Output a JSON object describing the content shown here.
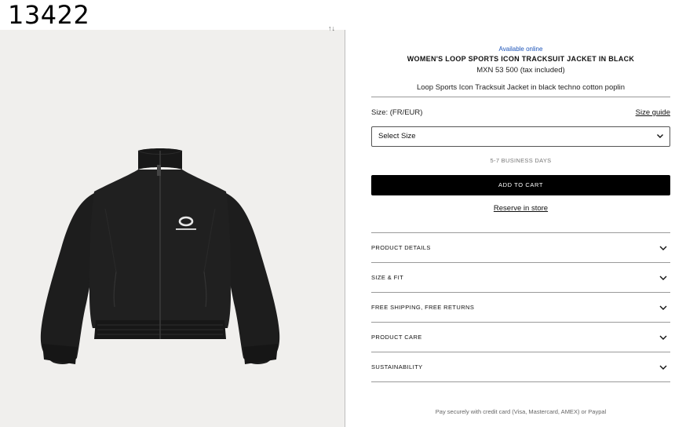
{
  "frame_id": "13422",
  "gallery": {
    "marker": "↑↓"
  },
  "product": {
    "availability": "Available online",
    "title": "WOMEN'S LOOP SPORTS ICON TRACKSUIT JACKET IN BLACK",
    "price": "MXN 53 500 (tax included)",
    "description": "Loop Sports Icon Tracksuit Jacket in black techno cotton poplin"
  },
  "size": {
    "label": "Size: (FR/EUR)",
    "guide_link": "Size guide",
    "select_value": "Select Size"
  },
  "delivery": "5-7 BUSINESS DAYS",
  "cart_button": "ADD TO CART",
  "reserve_link": "Reserve in store",
  "accordion": [
    {
      "label": "PRODUCT DETAILS"
    },
    {
      "label": "SIZE & FIT"
    },
    {
      "label": "FREE SHIPPING, FREE RETURNS"
    },
    {
      "label": "PRODUCT CARE"
    },
    {
      "label": "SUSTAINABILITY"
    }
  ],
  "payment_note": "Pay securely with credit card (Visa, Mastercard, AMEX) or Paypal",
  "colors": {
    "accent_link": "#1a52b8",
    "button_bg": "#000000",
    "jacket": "#1c1c1c"
  },
  "icons": {
    "select": "chevron-down-icon",
    "accordion": "chevron-down-icon"
  }
}
